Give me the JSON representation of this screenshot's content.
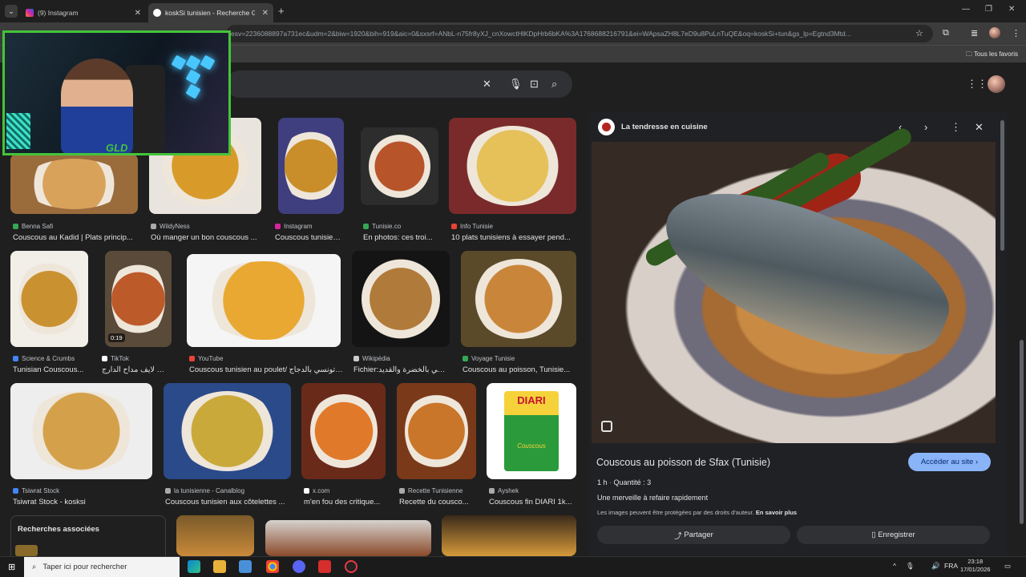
{
  "browser": {
    "tabs": [
      {
        "label": "(9) Instagram",
        "color": "#d6249f"
      },
      {
        "label": "koskSi tunisien - Recherche Goo",
        "color": "#4285f4"
      }
    ],
    "url": "esv=2236088897a731ec&udm=2&biw=1920&bih=919&aic=0&sxsrf=ANbL-n75fr8yXJ_cnXowctHlKDpHrb6bKA%3A1768688216791&ei=WApsaZH8L7eD9u8PuLnTuQE&oq=koskSi+tun&gs_lp=Egtnd3Mtd...",
    "bookmarks_label": "Tous les favoris"
  },
  "webcam": {
    "overlay_text": "GLD"
  },
  "results": [
    {
      "source": "Benna Safi",
      "title": "Couscous au Kadid | Plats princip...",
      "src_color": "#34a853",
      "colors": [
        "#9a6b3b",
        "#d9a25b"
      ]
    },
    {
      "source": "WildyNess",
      "title": "Où manger un bon couscous ...",
      "src_color": "#aaaaaa",
      "colors": [
        "#e9e4de",
        "#d89b2a"
      ]
    },
    {
      "source": "Instagram",
      "title": "Couscous tunisien ...",
      "src_color": "#d6249f",
      "colors": [
        "#3f3f7f",
        "#c98e2a"
      ]
    },
    {
      "source": "Tunisie.co",
      "title": "En photos: ces troi...",
      "src_color": "#34a853",
      "colors": [
        "#2d2d2d",
        "#b8542a"
      ]
    },
    {
      "source": "Info Tunisie",
      "title": "10 plats tunisiens à essayer pend...",
      "src_color": "#ea4335",
      "colors": [
        "#7a2a2a",
        "#e6c15a"
      ]
    },
    {
      "source": "Science & Crumbs",
      "title": "Tunisian Couscous...",
      "src_color": "#4285f4",
      "colors": [
        "#f2efe9",
        "#c99130"
      ]
    },
    {
      "source": "TikTok",
      "title": "كسكسي لايف مداح الدارج...",
      "src_color": "#ffffff",
      "colors": [
        "#5a4a3a",
        "#bc5a2a"
      ],
      "duration": "0:19"
    },
    {
      "source": "YouTube",
      "title": "Couscous tunisien au poulet/ كسكسي تونسي بالدجاج",
      "src_color": "#ea4335",
      "colors": [
        "#f5f5f5",
        "#e8a832"
      ]
    },
    {
      "source": "Wikipédia",
      "title": "Fichier:كسكسي بالخضرة والقديد...",
      "src_color": "#cccccc",
      "colors": [
        "#141414",
        "#b07a3a"
      ]
    },
    {
      "source": "Voyage Tunisie",
      "title": "Couscous au poisson, Tunisie...",
      "src_color": "#34a853",
      "colors": [
        "#5a4a2a",
        "#c9863a"
      ]
    },
    {
      "source": "Tsiwrat Stock",
      "title": "Tsiwrat Stock - kosksi",
      "src_color": "#4285f4",
      "colors": [
        "#eeeeee",
        "#d4a14a"
      ]
    },
    {
      "source": "la tunisienne - Canalblog",
      "title": "Couscous tunisien aux côtelettes ...",
      "src_color": "#aaaaaa",
      "colors": [
        "#2a4a8a",
        "#c9a93a"
      ]
    },
    {
      "source": "x.com",
      "title": "m'en fou des critique...",
      "src_color": "#ffffff",
      "colors": [
        "#6a2a1a",
        "#e07a2a"
      ]
    },
    {
      "source": "Recette Tunisienne",
      "title": "Recette du cousco...",
      "src_color": "#aaaaaa",
      "colors": [
        "#7a3a1a",
        "#c9762a"
      ]
    },
    {
      "source": "Ayshek",
      "title": "Couscous fin DIARI 1k...",
      "src_color": "#aaaaaa",
      "colors": [
        "#ffffff",
        "#2a9a3a"
      ],
      "brand": "DIARI",
      "brand_sub": "Couscous"
    }
  ],
  "related": {
    "title": "Recherches associées"
  },
  "panel": {
    "site": "La tendresse en cuisine",
    "title": "Couscous au poisson de Sfax (Tunisie)",
    "visit_label": "Accéder au site",
    "time": "1 h",
    "separator": "·",
    "quantity": "Quantité : 3",
    "description": "Une merveille à refaire rapidement",
    "copyright_text": "Les images peuvent être protégées par des droits d'auteur.",
    "copyright_link": "En savoir plus",
    "share_label": "Partager",
    "save_label": "Enregistrer"
  },
  "taskbar": {
    "search_placeholder": "Taper ici pour rechercher",
    "lang": "FRA",
    "time": "23:18",
    "date": "17/01/2026"
  }
}
